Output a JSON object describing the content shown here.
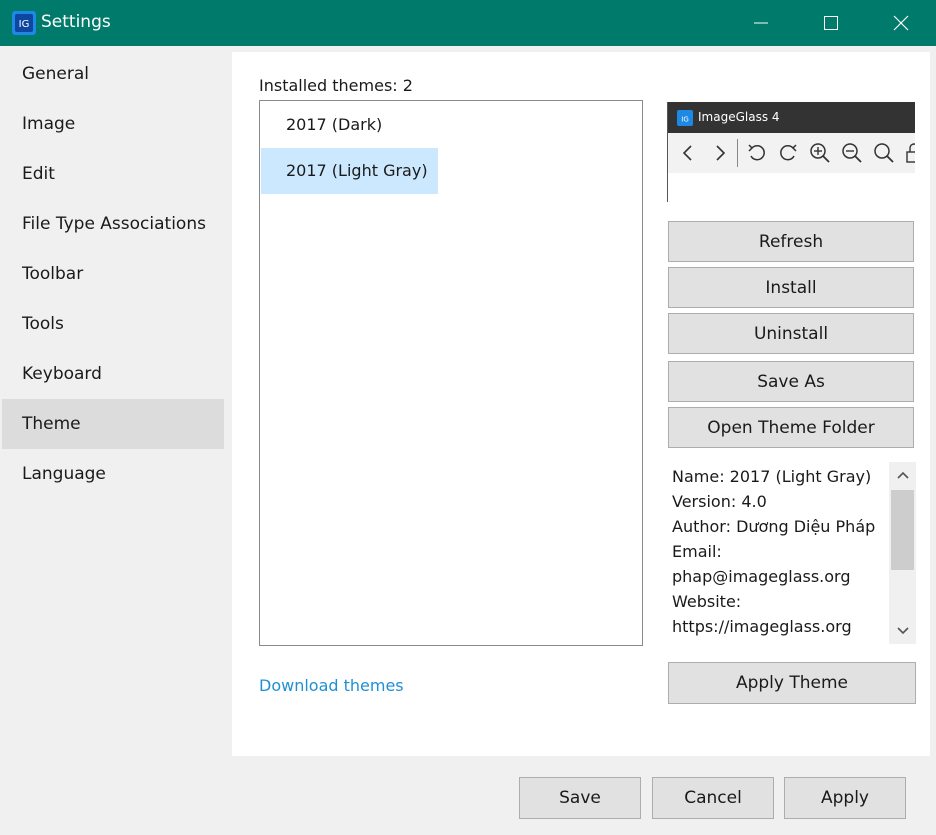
{
  "window": {
    "title": "Settings",
    "controls": {
      "minimize": "minimize",
      "maximize": "maximize",
      "close": "close"
    }
  },
  "sidebar": {
    "items": [
      {
        "label": "General"
      },
      {
        "label": "Image"
      },
      {
        "label": "Edit"
      },
      {
        "label": "File Type Associations"
      },
      {
        "label": "Toolbar"
      },
      {
        "label": "Tools"
      },
      {
        "label": "Keyboard"
      },
      {
        "label": "Theme",
        "active": true
      },
      {
        "label": "Language"
      }
    ]
  },
  "theme_page": {
    "installed_label": "Installed themes: 2",
    "themes": [
      {
        "name": "2017 (Dark)",
        "selected": false
      },
      {
        "name": "2017 (Light Gray)",
        "selected": true
      }
    ],
    "download_link": "Download themes",
    "preview": {
      "app_title": "ImageGlass 4",
      "tools": [
        "back-icon",
        "forward-icon",
        "rotate-left-icon",
        "rotate-right-icon",
        "zoom-in-icon",
        "zoom-out-icon",
        "zoom-fit-icon",
        "lock-icon"
      ]
    },
    "buttons": {
      "refresh": "Refresh",
      "install": "Install",
      "uninstall": "Uninstall",
      "save_as": "Save As",
      "open_folder": "Open Theme Folder",
      "apply_theme": "Apply Theme"
    },
    "info": {
      "name": "Name: 2017 (Light Gray)",
      "version": "Version: 4.0",
      "author": "Author: Dương Diệu Pháp",
      "email_label": "Email:",
      "email": "phap@imageglass.org",
      "website_label": "Website:",
      "website": "https://imageglass.org"
    }
  },
  "footer": {
    "save": "Save",
    "cancel": "Cancel",
    "apply": "Apply"
  },
  "colors": {
    "titlebar": "#007a6a",
    "selection": "#cce8ff",
    "link": "#1e90d4",
    "active_nav": "#dcdcdc"
  }
}
